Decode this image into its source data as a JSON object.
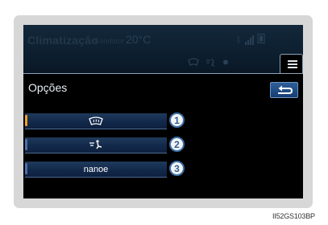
{
  "status_bar": {
    "title": "Climatização",
    "zone": "Condutor",
    "temperature": "20°C",
    "status_icons": [
      "bluetooth-icon",
      "signal-bars-icon",
      "phone-battery-icon"
    ],
    "mode_icons": [
      "windshield-defog-icon",
      "airflow-feet-icon",
      "recirculation-icon"
    ]
  },
  "menu_tab_icon": "list-menu-icon",
  "page": {
    "title": "Opções",
    "back_icon": "return-arrow-icon"
  },
  "options": [
    {
      "icon": "windshield-defog-icon",
      "label": "",
      "indicator_color": "#f0a020",
      "indicator_on": true
    },
    {
      "icon": "airflow-feet-icon",
      "label": "",
      "indicator_color": "#4a6fb0",
      "indicator_on": false
    },
    {
      "icon": "",
      "label": "nanoe",
      "indicator_color": "#4a6fb0",
      "indicator_on": false
    }
  ],
  "callouts": [
    "1",
    "2",
    "3"
  ],
  "caption": "II52GS103BP"
}
